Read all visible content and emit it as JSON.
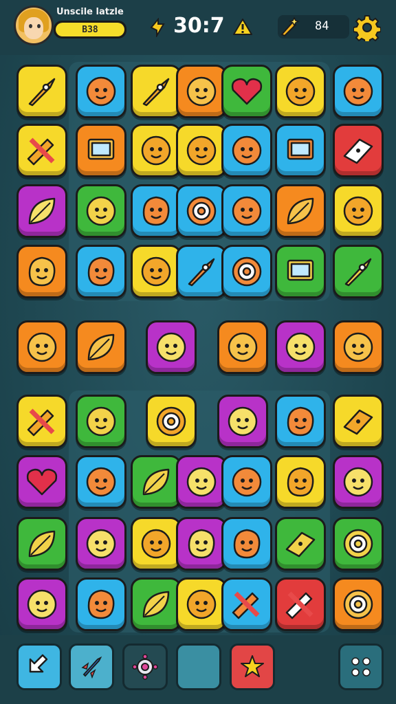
{
  "header": {
    "player_name": "Unscile latzle",
    "xp_value": "B38",
    "timer": "30:7",
    "coins": "84"
  },
  "colors": {
    "yellow": "#f6d92a",
    "orange": "#f58a1f",
    "blue": "#2fb3ea",
    "green": "#3fb83c",
    "purple": "#b832c8",
    "red": "#e23c3c",
    "teal": "#2a8ea0"
  },
  "board_rows": [
    [
      "rocket-icon",
      "blob-face-icon",
      "star-ship-icon",
      "girl-face-icon",
      "heart-gem-icon",
      "cat-face-icon",
      "fish-face-icon"
    ],
    [
      "pencils-icon",
      "laptop-icon",
      "blob-face-icon",
      "boy-face-icon",
      "smiley-pin-icon",
      "paper-icon",
      "dice-icon"
    ],
    [
      "leaf-icon",
      "cat-face-icon",
      "bottle-icon",
      "badge-icon",
      "monster-face-icon",
      "feather-icon",
      "smiley-icon"
    ],
    [
      "eggplant-icon",
      "splat-icon",
      "bald-face-icon",
      "bird-icon",
      "lollipop-icon",
      "notepad-icon",
      "rocket-icon"
    ],
    [
      "alien-face-icon",
      "leaf-icon",
      "",
      "crown-face-icon",
      "cat-face-icon",
      "crown-face-icon",
      "smiley-icon"
    ],
    [
      "pencils-icon",
      "boy-face-icon",
      "",
      "target-icon",
      "cat-face-icon",
      "shield-icon",
      "cake-icon"
    ],
    [
      "heart-icon",
      "bear-face-icon",
      "pepper-icon",
      "sun-face-icon",
      "cat-face-icon",
      "balloon-icon",
      "crown-face-icon"
    ],
    [
      "tulip-icon",
      "monster-face-icon",
      "bald-face-icon",
      "ufo-icon",
      "splat-icon",
      "gem-icon",
      "spiral-icon"
    ],
    [
      "sun-face-icon",
      "beetle-icon",
      "pear-icon",
      "alien-face-icon",
      "paintbrush-icon",
      "eraser-icon",
      "recycle-icon"
    ]
  ],
  "toolbar": [
    {
      "name": "back-button",
      "icon": "back-arrow-icon"
    },
    {
      "name": "rocket-power-button",
      "icon": "rocket-icon"
    },
    {
      "name": "bug-power-button",
      "icon": "bug-icon"
    },
    {
      "name": "empty-slot",
      "icon": ""
    },
    {
      "name": "star-power-button",
      "icon": "star-icon"
    },
    {
      "name": "menu-button",
      "icon": "dots-grid-icon"
    }
  ]
}
